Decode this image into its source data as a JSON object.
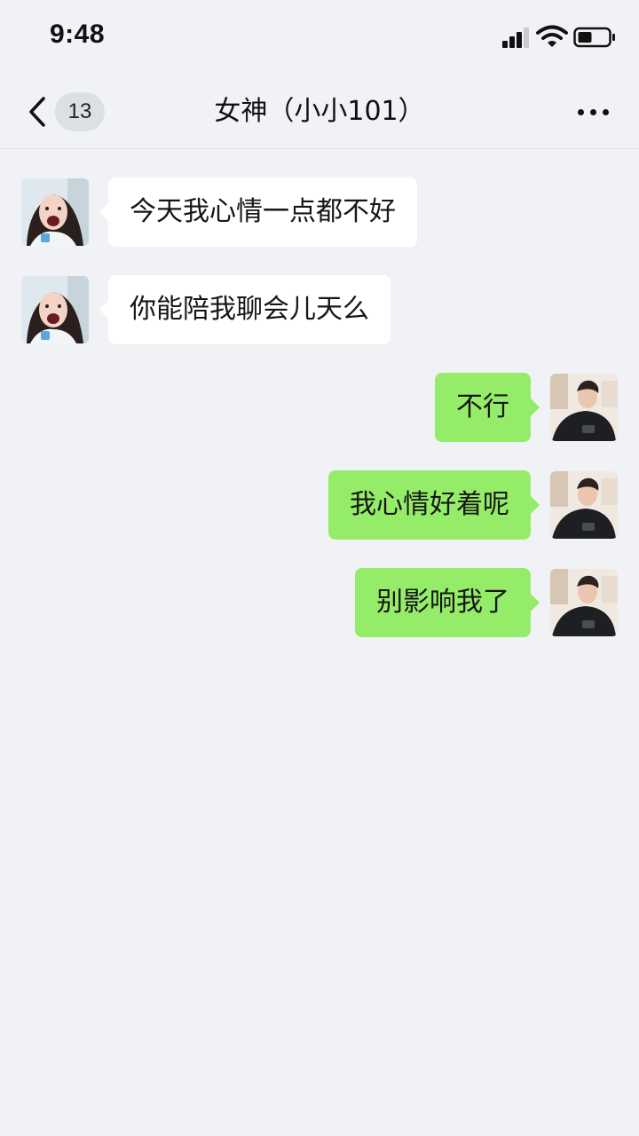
{
  "status_bar": {
    "time": "9:48",
    "icons": [
      "signal-icon",
      "wifi-icon",
      "battery-icon"
    ]
  },
  "nav": {
    "back_icon": "chevron-left-icon",
    "unread_count": "13",
    "title": "女神（小小101）",
    "more_icon": "more-dots-icon"
  },
  "messages": [
    {
      "side": "in",
      "text": "今天我心情一点都不好"
    },
    {
      "side": "in",
      "text": "你能陪我聊会儿天么"
    },
    {
      "side": "out",
      "text": "不行"
    },
    {
      "side": "out",
      "text": "我心情好着呢"
    },
    {
      "side": "out",
      "text": "别影响我了"
    }
  ],
  "colors": {
    "background": "#f1f2f6",
    "incoming_bubble": "#ffffff",
    "outgoing_bubble": "#95ec69",
    "badge": "#dcdfe4"
  }
}
